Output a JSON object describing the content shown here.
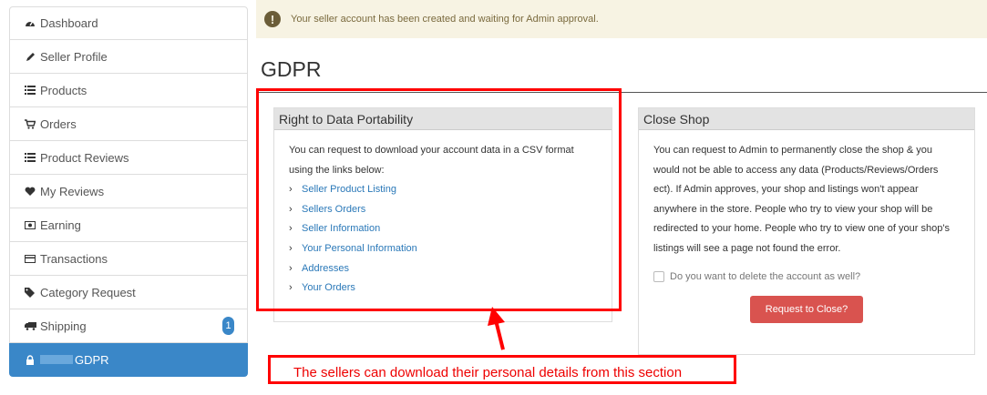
{
  "sidebar": {
    "items": [
      {
        "label": "Dashboard",
        "icon": "dashboard-icon"
      },
      {
        "label": "Seller Profile",
        "icon": "pencil-icon"
      },
      {
        "label": "Products",
        "icon": "list-icon"
      },
      {
        "label": "Orders",
        "icon": "cart-icon"
      },
      {
        "label": "Product Reviews",
        "icon": "list-icon"
      },
      {
        "label": "My Reviews",
        "icon": "heart-icon"
      },
      {
        "label": "Earning",
        "icon": "money-icon"
      },
      {
        "label": "Transactions",
        "icon": "credit-card-icon"
      },
      {
        "label": "Category Request",
        "icon": "tags-icon"
      },
      {
        "label": "Shipping",
        "icon": "truck-icon",
        "badge": "1"
      },
      {
        "label": "GDPR",
        "icon": "lock-icon",
        "active": true
      }
    ]
  },
  "notice": {
    "message": "Your seller account has been created and waiting for Admin approval.",
    "icon": "exclamation-icon"
  },
  "page": {
    "title": "GDPR"
  },
  "portability": {
    "heading": "Right to Data Portability",
    "description": "You can request to download your account data in a CSV format using the links below:",
    "links": [
      "Seller Product Listing",
      "Sellers Orders",
      "Seller Information",
      "Your Personal Information",
      "Addresses",
      "Your Orders"
    ]
  },
  "close_shop": {
    "heading": "Close Shop",
    "description": "You can request to Admin to permanently close the shop & you would not be able to access any data (Products/Reviews/Orders ect). If Admin approves, your shop and listings won't appear anywhere in the store. People who try to view your shop will be redirected to your home. People who try to view one of your shop's listings will see a page not found the error.",
    "checkbox_label": "Do you want to delete the account as well?",
    "button_label": "Request to Close?"
  },
  "annotation": {
    "text": "The sellers can download their personal details from this section"
  },
  "colors": {
    "accent": "#3a87c8",
    "danger": "#d9534f",
    "annotation": "#ff0000",
    "link": "#2a78b8"
  }
}
